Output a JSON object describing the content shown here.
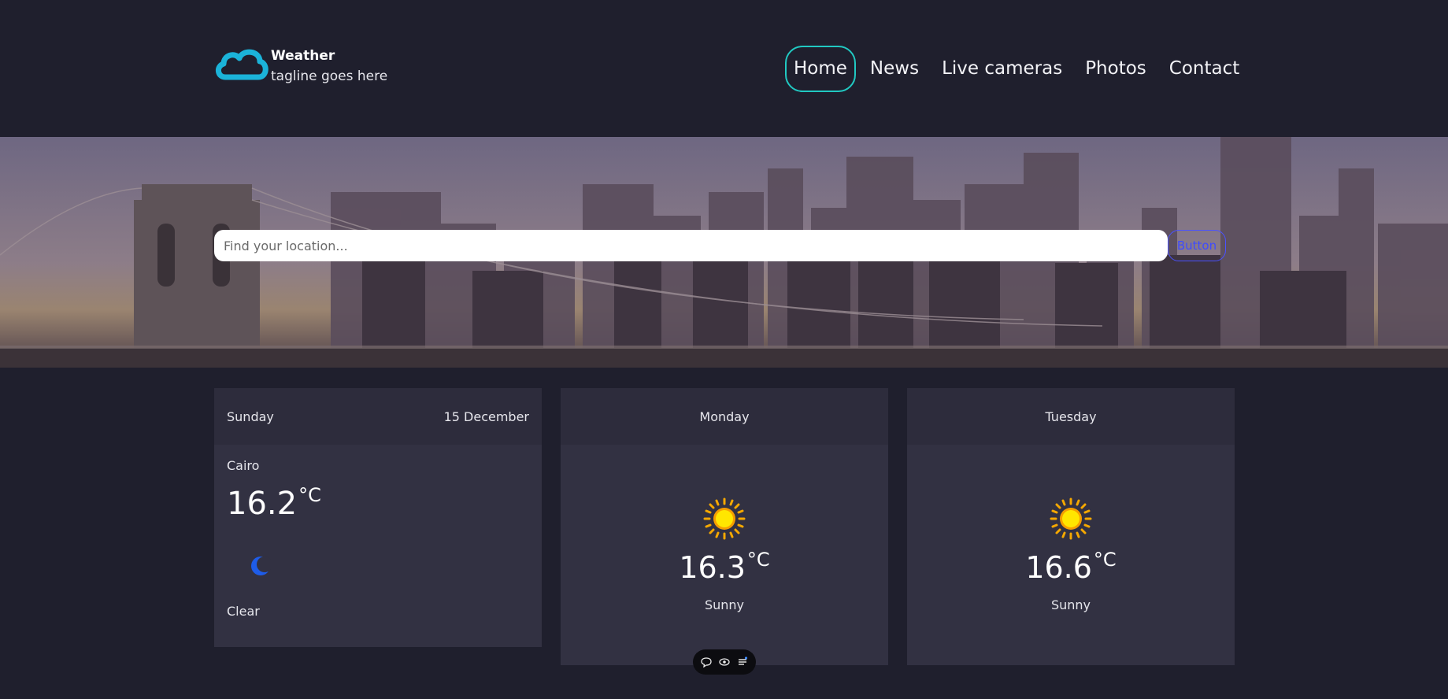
{
  "brand": {
    "title": "Weather",
    "tagline": "tagline goes here"
  },
  "nav": [
    {
      "label": "Home",
      "active": true
    },
    {
      "label": "News",
      "active": false
    },
    {
      "label": "Live cameras",
      "active": false
    },
    {
      "label": "Photos",
      "active": false
    },
    {
      "label": "Contact",
      "active": false
    }
  ],
  "search": {
    "placeholder": "Find your location...",
    "button_label": "Button"
  },
  "today": {
    "day": "Sunday",
    "date": "15 December",
    "city": "Cairo",
    "temp": "16.2",
    "unit": "°C",
    "condition": "Clear",
    "icon": "moon-icon"
  },
  "forecast": [
    {
      "day": "Monday",
      "temp": "16.3",
      "unit": "°C",
      "condition": "Sunny",
      "icon": "sun-icon"
    },
    {
      "day": "Tuesday",
      "temp": "16.6",
      "unit": "°C",
      "condition": "Sunny",
      "icon": "sun-icon"
    }
  ],
  "colors": {
    "background": "#1f1f2d",
    "card": "#323142",
    "card_header": "#2d2c3c",
    "accent": "#21c9c2",
    "logo": "#1bb3d9",
    "sun": "#f5c400",
    "moon": "#1e5ce8"
  }
}
